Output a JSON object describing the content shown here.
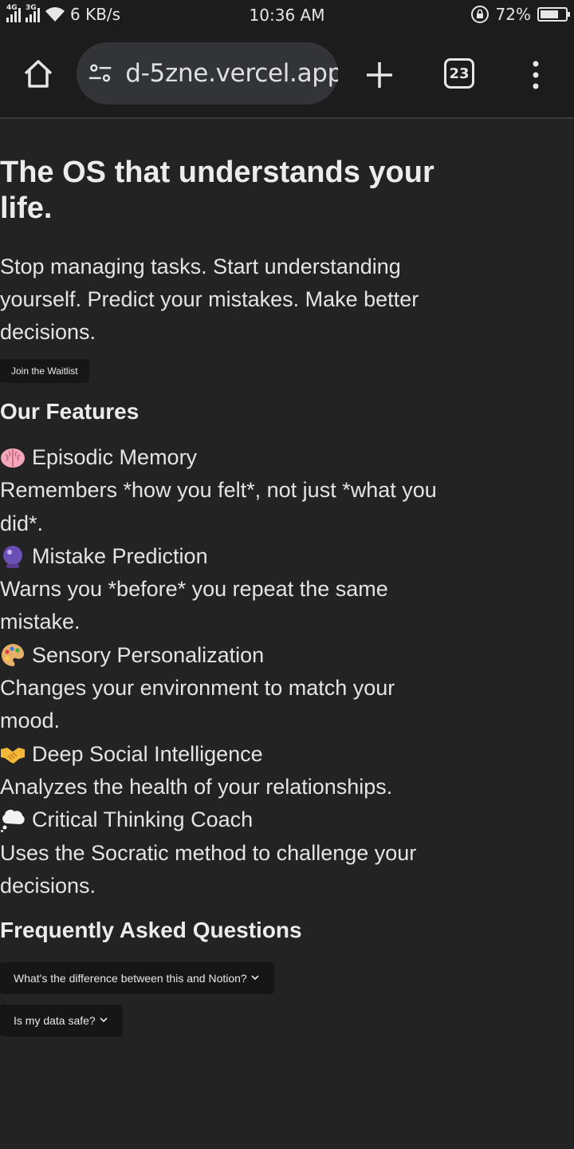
{
  "status_bar": {
    "network_1": "4G",
    "network_2": "3G",
    "speed": "6 KB/s",
    "time": "10:36 AM",
    "battery": "72%",
    "battery_level": 0.72
  },
  "browser": {
    "url": "d-5zne.vercel.app",
    "tab_count": "23"
  },
  "hero": {
    "title": "The OS that understands your life.",
    "subtitle": "Stop managing tasks. Start understanding yourself. Predict your mistakes. Make better decisions.",
    "cta": "Join the Waitlist"
  },
  "features": {
    "title": "Our Features",
    "items": [
      {
        "icon": "brain-icon",
        "name": "Episodic Memory",
        "desc": "Remembers *how you felt*, not just *what you did*."
      },
      {
        "icon": "crystal-ball-icon",
        "name": "Mistake Prediction",
        "desc": "Warns you *before* you repeat the same mistake."
      },
      {
        "icon": "palette-icon",
        "name": "Sensory Personalization",
        "desc": "Changes your environment to match your mood."
      },
      {
        "icon": "handshake-icon",
        "name": "Deep Social Intelligence",
        "desc": "Analyzes the health of your relationships."
      },
      {
        "icon": "thought-bubble-icon",
        "name": "Critical Thinking Coach",
        "desc": "Uses the Socratic method to challenge your decisions."
      }
    ]
  },
  "faq": {
    "title": "Frequently Asked Questions",
    "items": [
      {
        "question": "What's the difference between this and Notion?"
      },
      {
        "question": "Is my data safe?"
      }
    ]
  },
  "colors": {
    "background": "#232323",
    "toolbar": "#1c1c1c",
    "button": "#161616",
    "url_pill": "#333437"
  }
}
